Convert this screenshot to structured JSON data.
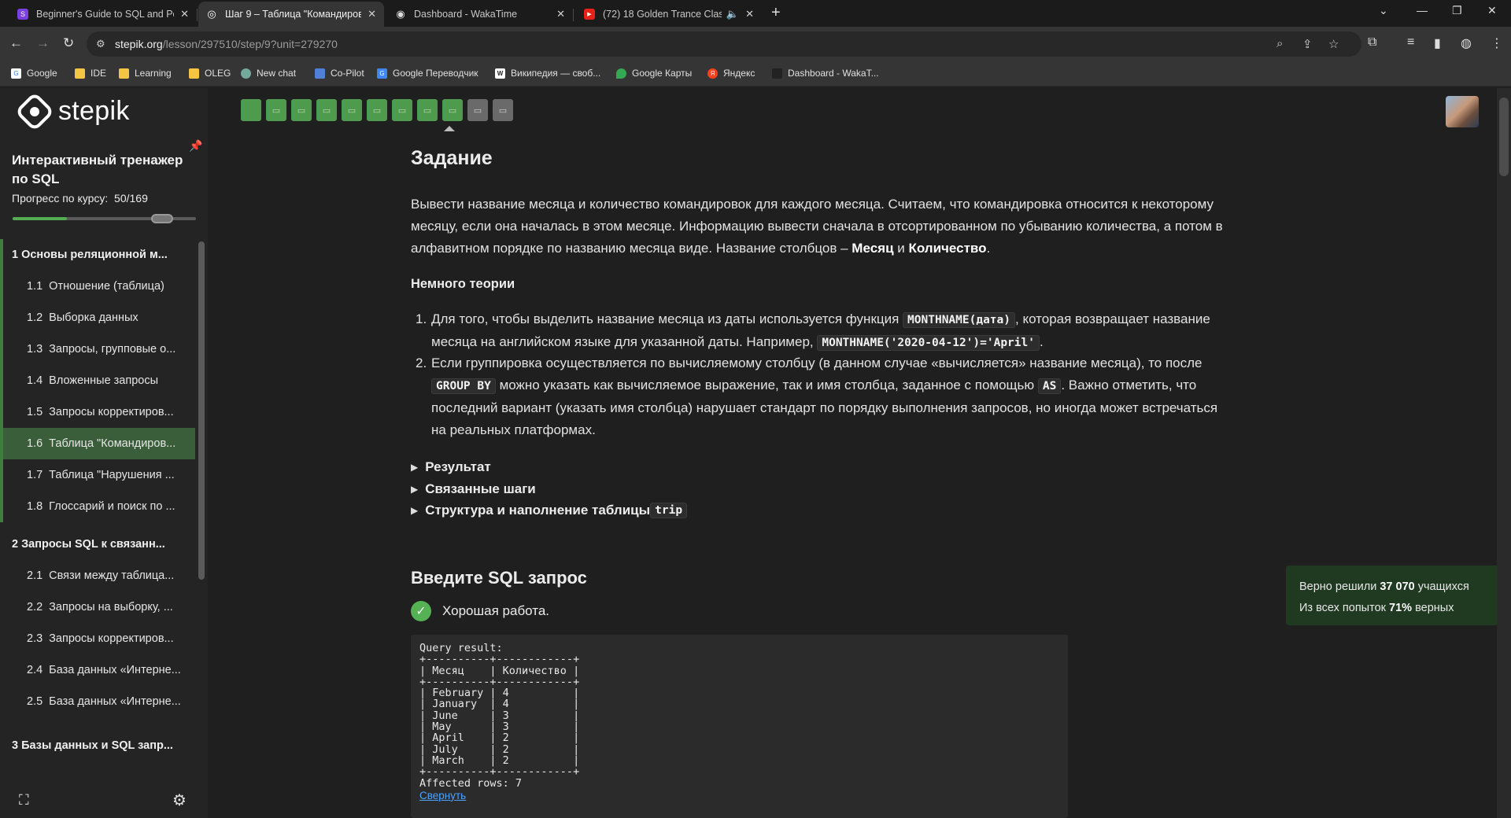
{
  "browser": {
    "tabs": [
      {
        "title": "Beginner's Guide to SQL and Po",
        "color": "#7b3fe4",
        "glyph": "S"
      },
      {
        "title": "Шаг 9 – Таблица \"Командиров",
        "color": "#ffffff",
        "glyph": "◎"
      },
      {
        "title": "Dashboard - WakaTime",
        "color": "#222222",
        "glyph": "◉"
      },
      {
        "title": "(72) 18 Golden Trance Clas",
        "color": "#e62117",
        "glyph": "▶"
      }
    ],
    "address": {
      "host": "stepik.org",
      "path": "/lesson/297510/step/9?unit=279270"
    },
    "bookmarks": [
      {
        "label": "Google",
        "color": "#ffffff"
      },
      {
        "label": "IDE",
        "color": "#f4c542"
      },
      {
        "label": "Learning",
        "color": "#f4c542"
      },
      {
        "label": "OLEG",
        "color": "#f4c542"
      },
      {
        "label": "New chat",
        "color": "#74aa9c"
      },
      {
        "label": "Co-Pilot",
        "color": "#4f7fd6"
      },
      {
        "label": "Google Переводчик",
        "color": "#4285f4"
      },
      {
        "label": "Википедия — своб...",
        "color": "#ffffff"
      },
      {
        "label": "Google Карты",
        "color": "#34a853"
      },
      {
        "label": "Яндекс",
        "color": "#fc3f1d"
      },
      {
        "label": "Dashboard - WakaT...",
        "color": "#222222"
      }
    ]
  },
  "sidebar": {
    "logo": "stepik",
    "course_title": "Интерактивный тренажер по SQL",
    "progress_label": "Прогресс по курсу:",
    "progress_value": "50/169",
    "progress_fraction": 0.296,
    "modules": [
      {
        "label": "1  Основы реляционной м..."
      },
      {
        "label": "2  Запросы SQL к связанн..."
      },
      {
        "label": "3  Базы данных и SQL запр..."
      }
    ],
    "lessons_m1": [
      {
        "num": "1.1",
        "label": "Отношение (таблица)"
      },
      {
        "num": "1.2",
        "label": "Выборка данных"
      },
      {
        "num": "1.3",
        "label": "Запросы, групповые о..."
      },
      {
        "num": "1.4",
        "label": "Вложенные запросы"
      },
      {
        "num": "1.5",
        "label": "Запросы корректиров..."
      },
      {
        "num": "1.6",
        "label": "Таблица \"Командиров..."
      },
      {
        "num": "1.7",
        "label": "Таблица \"Нарушения ..."
      },
      {
        "num": "1.8",
        "label": "Глоссарий и поиск по ..."
      }
    ],
    "lessons_m2": [
      {
        "num": "2.1",
        "label": "Связи между таблица..."
      },
      {
        "num": "2.2",
        "label": "Запросы на выборку, ..."
      },
      {
        "num": "2.3",
        "label": "Запросы корректиров..."
      },
      {
        "num": "2.4",
        "label": "База данных «Интерне..."
      },
      {
        "num": "2.5",
        "label": "База данных «Интерне..."
      }
    ]
  },
  "steps": {
    "count": 11,
    "passed": 9,
    "current_index": 8
  },
  "task": {
    "heading": "Задание",
    "p1a": "Вывести название месяца и количество командировок для каждого месяца. Считаем, что командировка относится к некоторому",
    "p1b": "месяцу, если она началась в этом месяце. Информацию вывести сначала в отсортированном по убыванию количества, а потом в",
    "p1c": "алфавитном порядке по названию месяца виде. Название столбцов – ",
    "col1": "Месяц",
    "and": " и ",
    "col2": "Количество",
    "dot": ".",
    "theory_heading": "Немного теории",
    "li1_num": "1.",
    "li1_a": "Для того, чтобы выделить название месяца из даты используется функция ",
    "li1_code1": "MONTHNAME(дата)",
    "li1_b": ", которая возвращает название",
    "li1_c": "месяца на английском языке для указанной даты. Например, ",
    "li1_code2": "MONTHNAME('2020-04-12')='April'",
    "li1_d": ".",
    "li2_num": "2.",
    "li2_a": "Если группировка осуществляется по вычисляемому столбцу (в данном случае «вычисляется» название месяца), то после",
    "li2_code1": "GROUP BY",
    "li2_b": " можно указать как вычисляемое выражение, так и имя столбца, заданное с помощью ",
    "li2_code2": "AS",
    "li2_c": ". Важно отметить, что",
    "li2_d": "последний вариант (указать имя столбца)  нарушает стандарт по порядку выполнения запросов, но иногда может встречаться",
    "li2_e": "на реальных платформах.",
    "details": [
      "Результат",
      "Связанные шаги"
    ],
    "details3": "Структура и наполнение таблицы ",
    "details3_code": "trip"
  },
  "answer": {
    "heading": "Введите SQL запрос",
    "status": "Хорошая работа.",
    "stats_line1_a": "Верно решили ",
    "stats_line1_num": "37 070",
    "stats_line1_b": " учащихся",
    "stats_line2_a": "Из всех попыток ",
    "stats_line2_num": "71%",
    "stats_line2_b": " верных",
    "result_text": "Query result:\n+----------+------------+\n| Месяц    | Количество |\n+----------+------------+\n| February | 4          |\n| January  | 4          |\n| June     | 3          |\n| May      | 3          |\n| April    | 2          |\n| July     | 2          |\n| March    | 2          |\n+----------+------------+\nAffected rows: 7",
    "collapse_label": "Свернуть"
  }
}
